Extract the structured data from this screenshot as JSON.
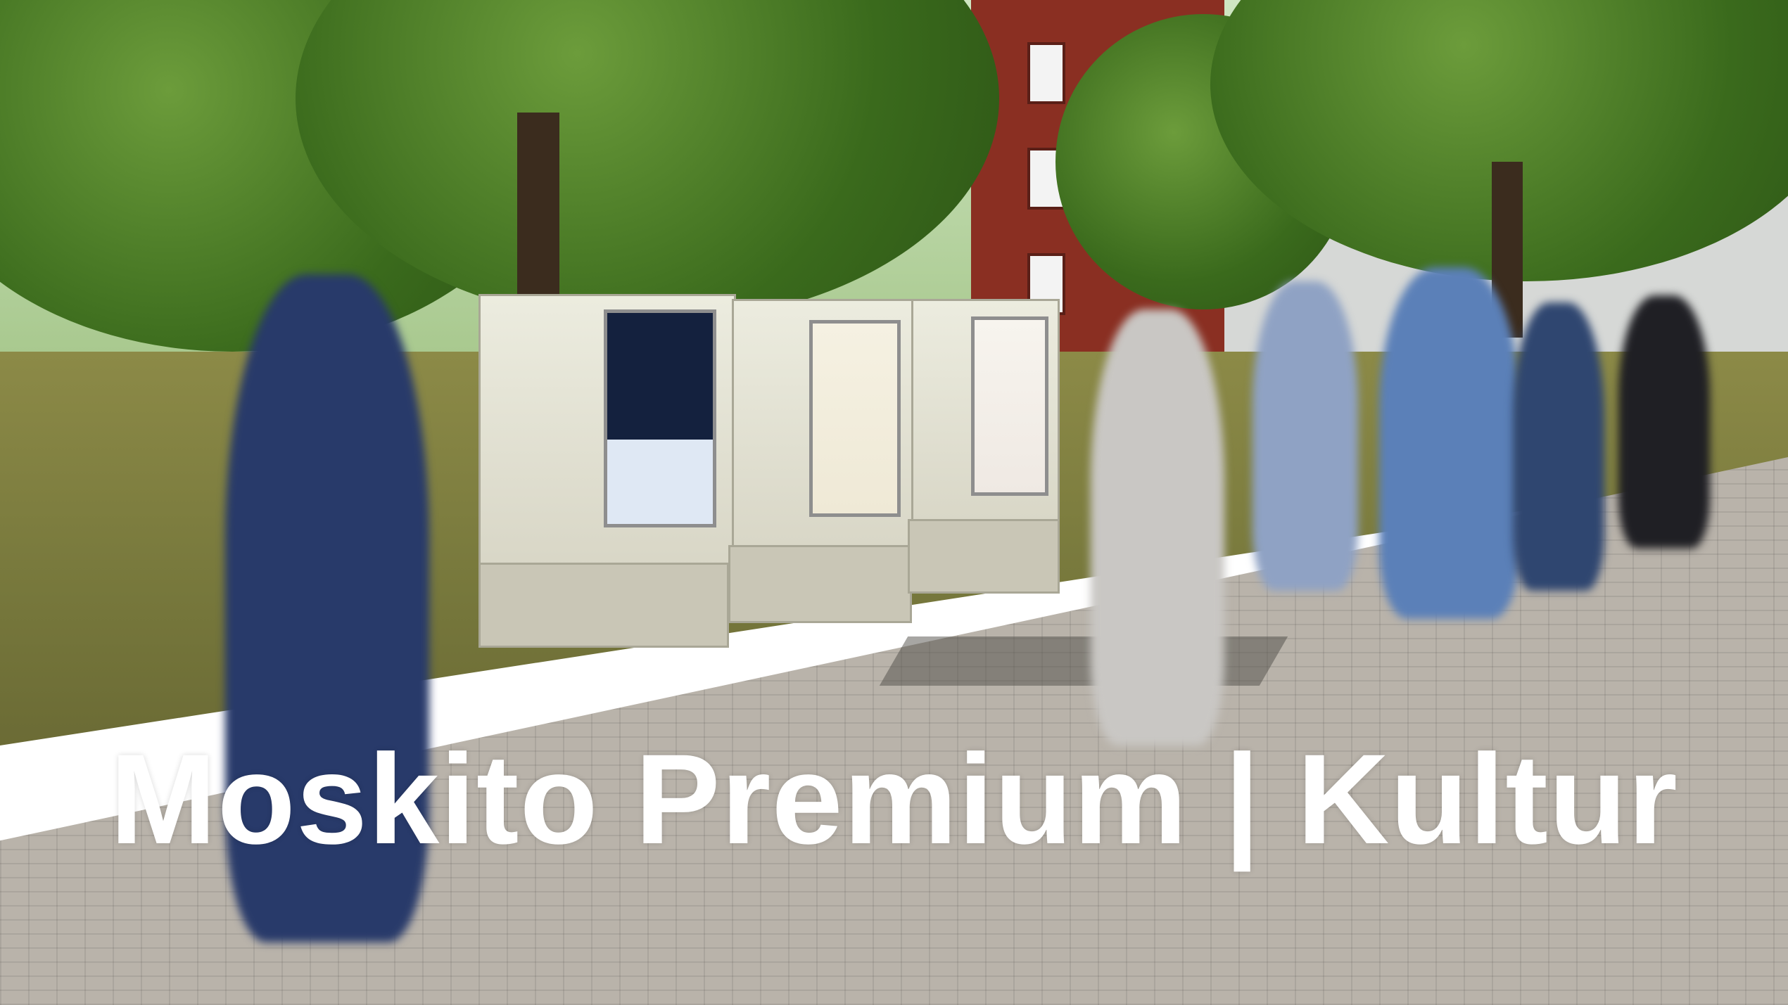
{
  "headline": "Moskito Premium | Kultur",
  "colors": {
    "headline_text": "#ffffff",
    "foliage": "#3a6a1c",
    "pavement": "#b9b3aa",
    "brick_building": "#8a2f22"
  }
}
